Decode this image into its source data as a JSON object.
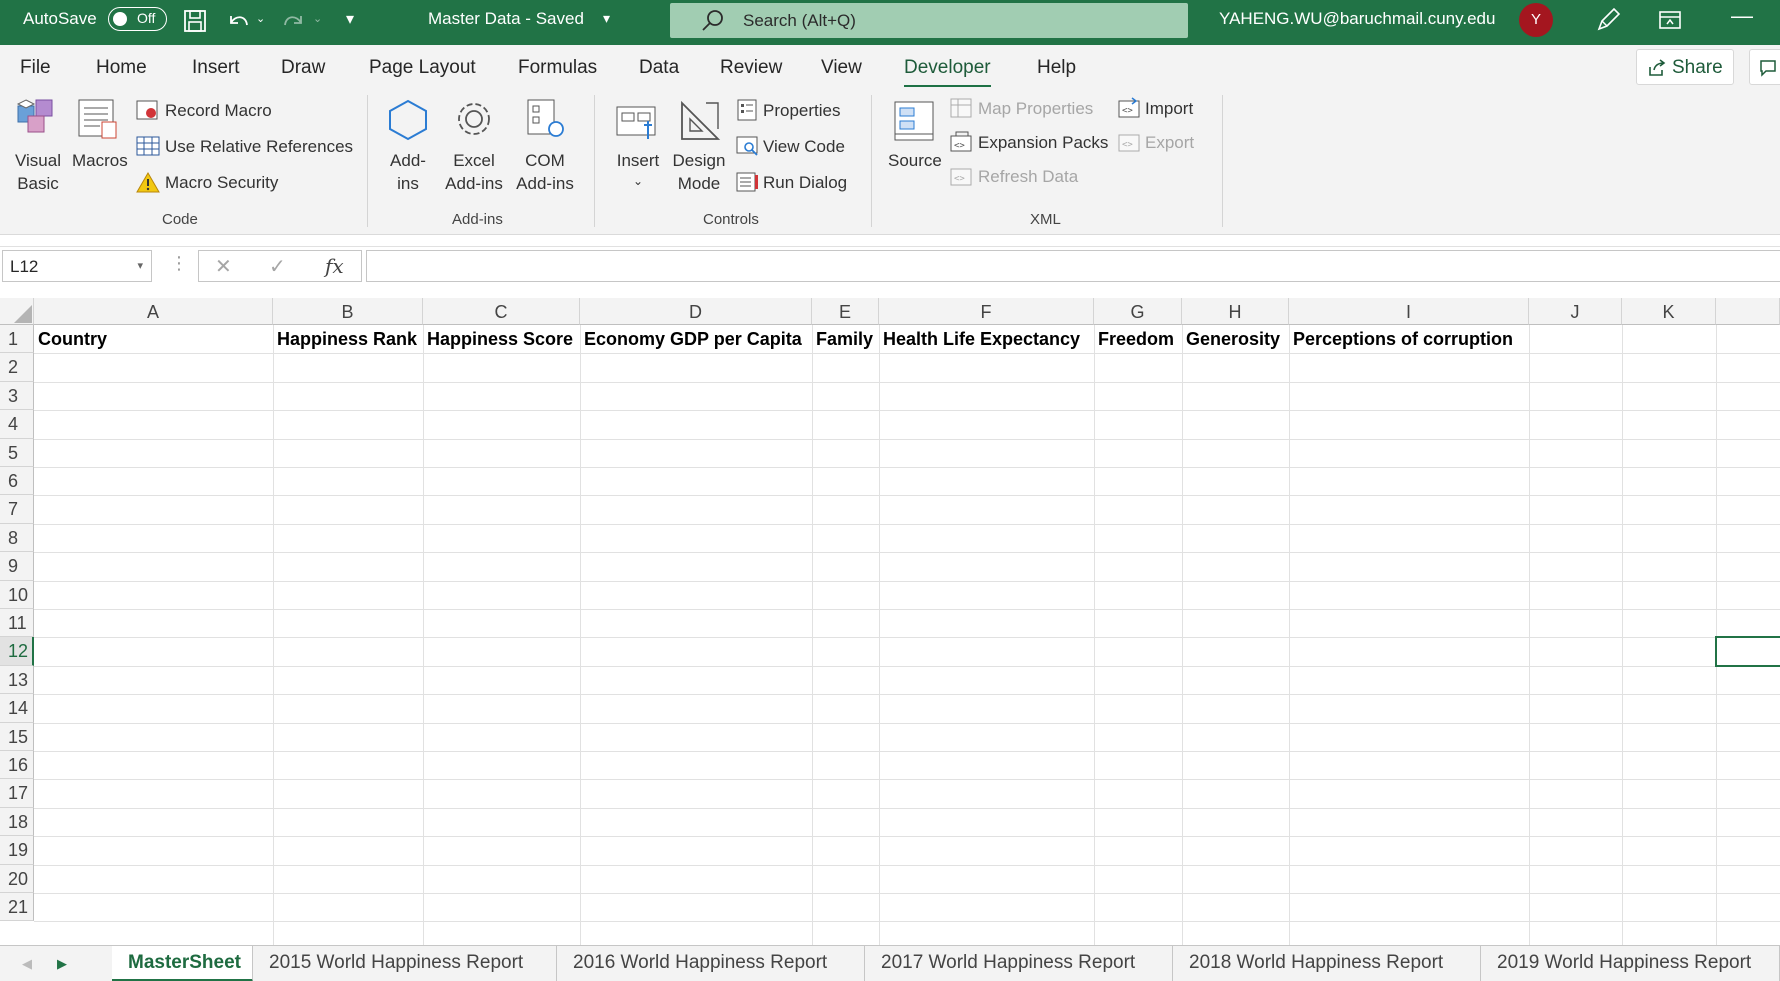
{
  "titlebar": {
    "autosave_label": "AutoSave",
    "autosave_state": "Off",
    "document_title": "Master Data  -  Saved",
    "search_placeholder": "Search (Alt+Q)",
    "account": "YAHENG.WU@baruchmail.cuny.edu",
    "avatar_initial": "Y",
    "accent_color": "#217346"
  },
  "tabs": [
    "File",
    "Home",
    "Insert",
    "Draw",
    "Page Layout",
    "Formulas",
    "Data",
    "Review",
    "View",
    "Developer",
    "Help"
  ],
  "active_tab": "Developer",
  "share_label": "Share",
  "ribbon": {
    "code": {
      "label": "Code",
      "visual_basic_1": "Visual",
      "visual_basic_2": "Basic",
      "macros": "Macros",
      "record_macro": "Record Macro",
      "relative_refs": "Use Relative References",
      "macro_security": "Macro Security"
    },
    "addins": {
      "label": "Add-ins",
      "addins_1": "Add-",
      "addins_2": "ins",
      "excel_1": "Excel",
      "excel_2": "Add-ins",
      "com_1": "COM",
      "com_2": "Add-ins"
    },
    "controls": {
      "label": "Controls",
      "insert": "Insert",
      "design_1": "Design",
      "design_2": "Mode",
      "properties": "Properties",
      "view_code": "View Code",
      "run_dialog": "Run Dialog"
    },
    "xml": {
      "label": "XML",
      "source": "Source",
      "map_properties": "Map Properties",
      "expansion_packs": "Expansion Packs",
      "refresh_data": "Refresh Data",
      "import": "Import",
      "export": "Export"
    }
  },
  "formula_bar": {
    "name_box": "L12",
    "formula": "",
    "fx": "fx"
  },
  "columns": [
    "A",
    "B",
    "C",
    "D",
    "E",
    "F",
    "G",
    "H",
    "I",
    "J",
    "K"
  ],
  "rows": [
    "1",
    "2",
    "3",
    "4",
    "5",
    "6",
    "7",
    "8",
    "9",
    "10",
    "11",
    "12",
    "13",
    "14",
    "15",
    "16",
    "17",
    "18",
    "19",
    "20",
    "21"
  ],
  "active_row": "12",
  "header_row": [
    "Country",
    "Happiness Rank",
    "Happiness Score",
    "Economy GDP per Capita",
    "Family",
    "Health Life Expectancy",
    "Freedom",
    "Generosity",
    "Perceptions of corruption"
  ],
  "sheets": [
    "MasterSheet",
    "2015 World Happiness Report",
    "2016 World Happiness Report",
    "2017 World Happiness Report",
    "2018 World Happiness Report",
    "2019 World Happiness Report"
  ],
  "active_sheet": "MasterSheet"
}
